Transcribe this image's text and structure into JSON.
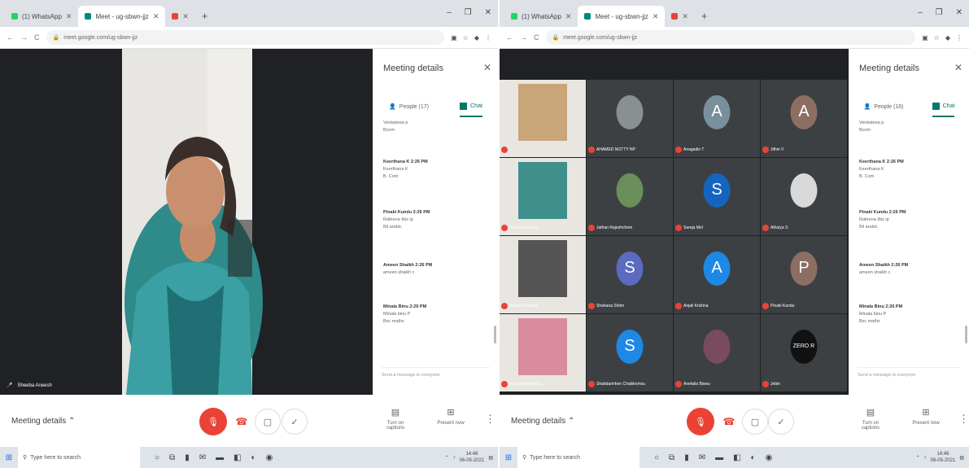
{
  "left": {
    "tabs": [
      {
        "label": "(1) WhatsApp",
        "color": "#25d366"
      },
      {
        "label": "Meet - ug-sbwn-jjz",
        "color": "#00897b"
      },
      {
        "label": "",
        "color": "#ea4335"
      }
    ],
    "window_controls": [
      "–",
      "❐",
      "✕"
    ],
    "url": "meet.google.com/ug-sbwn-jjz",
    "speaker_name": "Sheeba Aneesh",
    "details": {
      "title": "Meeting details",
      "people": "People (17)",
      "chat": "Chat"
    },
    "messages": [
      {
        "lines": [
          "Venkatesa p",
          "Bcom"
        ]
      },
      {
        "author": "Keerthana K 2:26 PM",
        "lines": [
          "Keerthana K",
          "B. Com"
        ]
      },
      {
        "author": "Pinaki Kundu 2:26 PM",
        "lines": [
          "Rafeena Ibiz ip",
          "Bil arabic"
        ]
      },
      {
        "author": "Ameen Shaikh 2:26 PM",
        "lines": [
          "ameen shaikh c"
        ]
      },
      {
        "author": "Minala Binu 2:26 PM",
        "lines": [
          "Minala binu P",
          "Bsc maths"
        ]
      }
    ],
    "send_placeholder": "Send a message to everyone",
    "meeting_details": "Meeting details",
    "side_buttons": [
      "Turn on captions",
      "Present now"
    ]
  },
  "right": {
    "tabs": [
      {
        "label": "(1) WhatsApp",
        "color": "#25d366"
      },
      {
        "label": "Meet - ug-sbwn-jjz",
        "color": "#00897b"
      },
      {
        "label": "",
        "color": "#ea4335"
      }
    ],
    "window_controls": [
      "–",
      "❐",
      "✕"
    ],
    "url": "meet.google.com/ug-sbwn-jjz",
    "details": {
      "title": "Meeting details",
      "people": "People (16)",
      "chat": "Chat"
    },
    "messages": [
      {
        "lines": [
          "Venkatesa p",
          "Bcom"
        ]
      },
      {
        "author": "Keerthana K 2:26 PM",
        "lines": [
          "Keerthana K",
          "B. Com"
        ]
      },
      {
        "author": "Pinaki Kundu 2:26 PM",
        "lines": [
          "Rafeena Ibiz ip",
          "Bil arabic"
        ]
      },
      {
        "author": "Ameen Shaikh 2:26 PM",
        "lines": [
          "ameen shaikh c"
        ]
      },
      {
        "author": "Minala Binu 2:26 PM",
        "lines": [
          "Minala binu P",
          "Bsc maths"
        ]
      }
    ],
    "send_placeholder": "Send a message to everyone",
    "meeting_details": "Meeting details",
    "side_buttons": [
      "Turn on captions",
      "Present now"
    ],
    "tiles": [
      {
        "name": "",
        "kind": "photo",
        "color": "#c9a57a"
      },
      {
        "name": "AHAMED NOTTY NP",
        "kind": "photo",
        "color": "#8a8f92"
      },
      {
        "name": "Anagadin T",
        "kind": "letter",
        "letter": "A",
        "color": "#78909c"
      },
      {
        "name": "Jithin V",
        "kind": "letter",
        "letter": "A",
        "color": "#8d6e63"
      },
      {
        "name": "Sheeba Aneesh",
        "kind": "photo",
        "color": "#3f8f8c"
      },
      {
        "name": "Jathan Rajeshchem",
        "kind": "photo",
        "color": "#6a8f5a"
      },
      {
        "name": "Sareja Mol",
        "kind": "letter",
        "letter": "S",
        "color": "#1565c0"
      },
      {
        "name": "Athulya S",
        "kind": "photo",
        "color": "#d9d9d9"
      },
      {
        "name": "Rafeena Thasni",
        "kind": "photo",
        "color": "#555555"
      },
      {
        "name": "Shahana Shirin",
        "kind": "letter",
        "letter": "S",
        "color": "#5c6bc0"
      },
      {
        "name": "Anjali Krishna",
        "kind": "letter",
        "letter": "A",
        "color": "#1e88e5"
      },
      {
        "name": "Pinaki Kundu",
        "kind": "letter",
        "letter": "P",
        "color": "#8d6e63"
      },
      {
        "name": "minnah parvathizz",
        "kind": "photo",
        "color": "#d98ba0"
      },
      {
        "name": "Shabdarinhen Chakikomsu",
        "kind": "letter",
        "letter": "S",
        "color": "#1e88e5"
      },
      {
        "name": "Anefalia Biswu",
        "kind": "photo",
        "color": "#7a4a5e"
      },
      {
        "name": "Jebin",
        "kind": "letter",
        "letter": "ZERO R",
        "color": "#111111"
      }
    ]
  },
  "taskbar": {
    "search_placeholder": "Type here to search",
    "time": "14:46",
    "date": "06-05-2021"
  }
}
